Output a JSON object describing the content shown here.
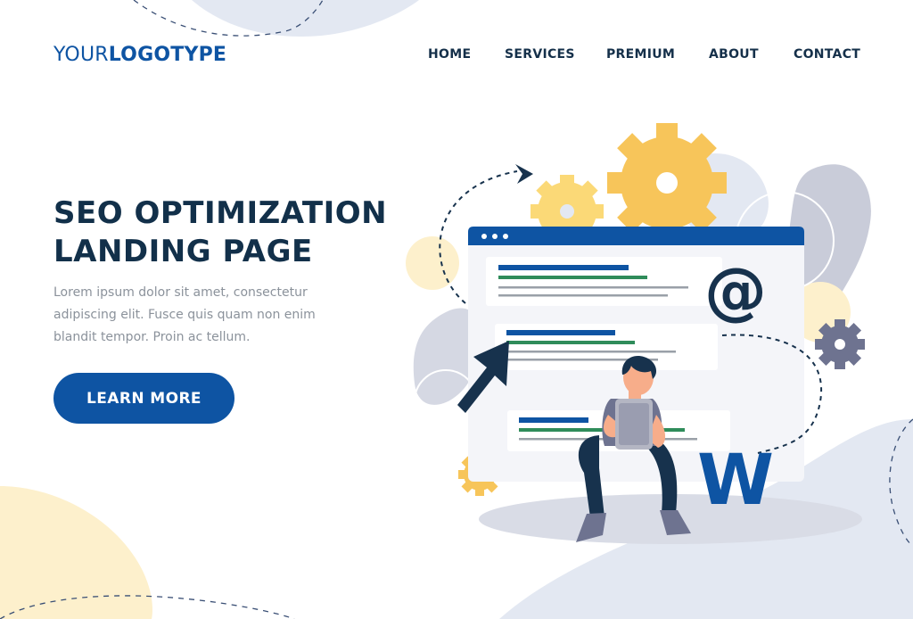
{
  "logo": {
    "prefix": "YOUR",
    "suffix": "LOGOTYPE"
  },
  "nav": {
    "home": "HOME",
    "services": "SERVICES",
    "premium": "PREMIUM",
    "about": "ABOUT",
    "contact": "CONTACT"
  },
  "hero": {
    "title_line1": "SEO OPTIMIZATION",
    "title_line2": "LANDING PAGE",
    "description": "Lorem ipsum dolor sit amet, consectetur adipiscing elit. Fusce quis quam non enim blandit tempor. Proin ac tellum.",
    "cta_label": "LEARN MORE"
  },
  "illustration": {
    "at_symbol": "@",
    "w_letter": "W"
  },
  "colors": {
    "brand_blue": "#0e54a3",
    "dark_text": "#12304a",
    "muted_text": "#8b929b",
    "gear_yellow": "#f7c55a",
    "blob_blue": "#e3e8f2",
    "blob_yellow": "#fdf0cc"
  }
}
